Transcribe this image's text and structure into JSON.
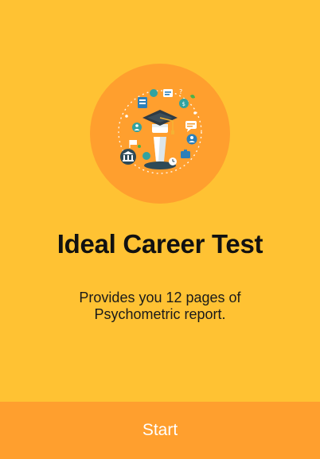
{
  "app": {
    "title": "Ideal Career Test",
    "description_line1": "Provides you 12 pages of",
    "description_line2": "Psychometric report.",
    "start_label": "Start"
  },
  "colors": {
    "background": "#FFC233",
    "accent": "#FF9F2E",
    "title_text": "#111111",
    "button_text": "#ffffff"
  },
  "hero": {
    "icon": "graduation-cap-career-icon"
  }
}
